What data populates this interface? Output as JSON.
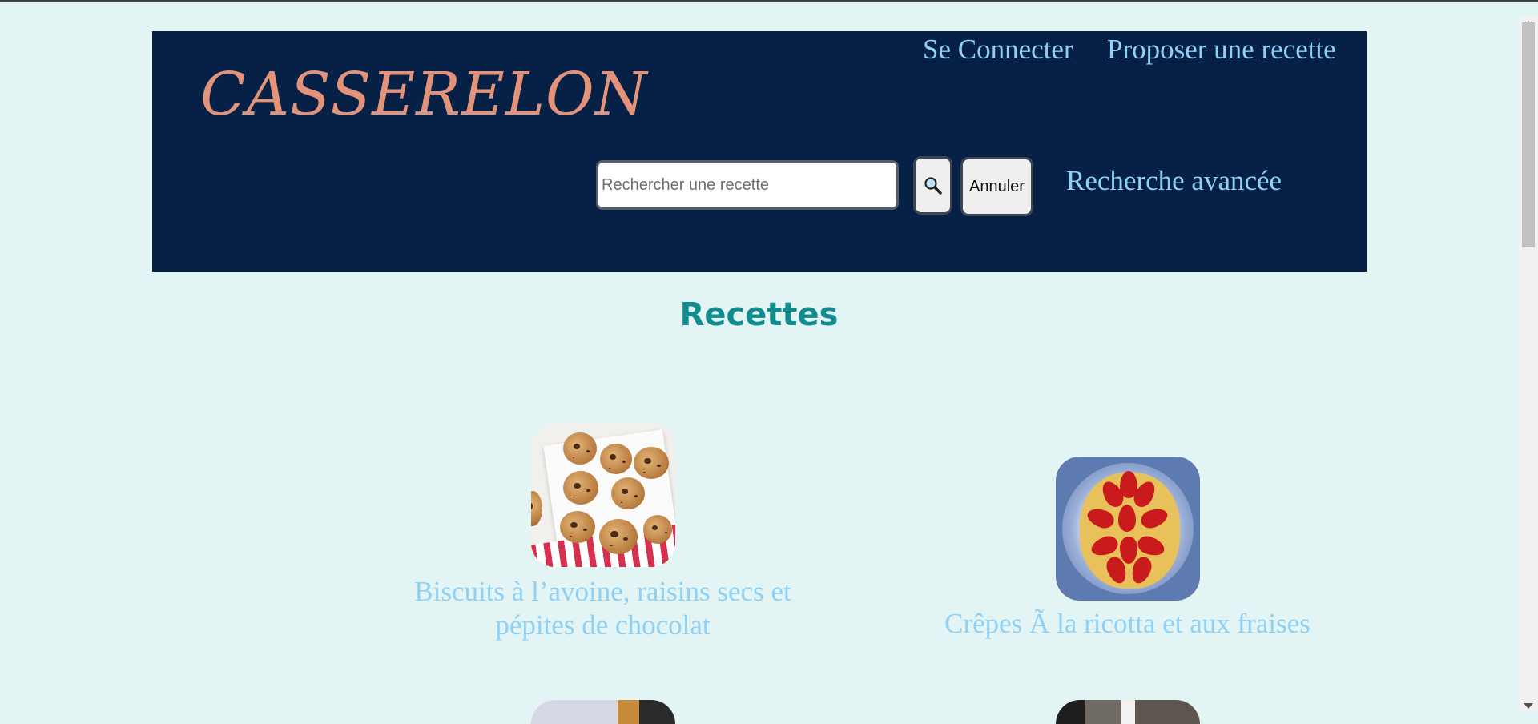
{
  "header": {
    "logo": "CASSERELON",
    "nav": {
      "login": "Se Connecter",
      "propose": "Proposer une recette"
    },
    "search": {
      "placeholder": "Rechercher une recette",
      "value": "",
      "search_icon": "magnifier-icon",
      "cancel_label": "Annuler"
    },
    "advanced_search": "Recherche avancée"
  },
  "main": {
    "title": "Recettes",
    "recipes": [
      {
        "title": "Biscuits à l’avoine, raisins secs et pépites de chocolat",
        "image": "cookies-photo"
      },
      {
        "title": "Crêpes Ã  la ricotta et aux fraises",
        "image": "strawberry-crepe-photo"
      }
    ]
  },
  "colors": {
    "background": "#e2f4f4",
    "header_bg": "#072146",
    "logo": "#e3937a",
    "link": "#8fd0f5",
    "title": "#118b8d"
  }
}
